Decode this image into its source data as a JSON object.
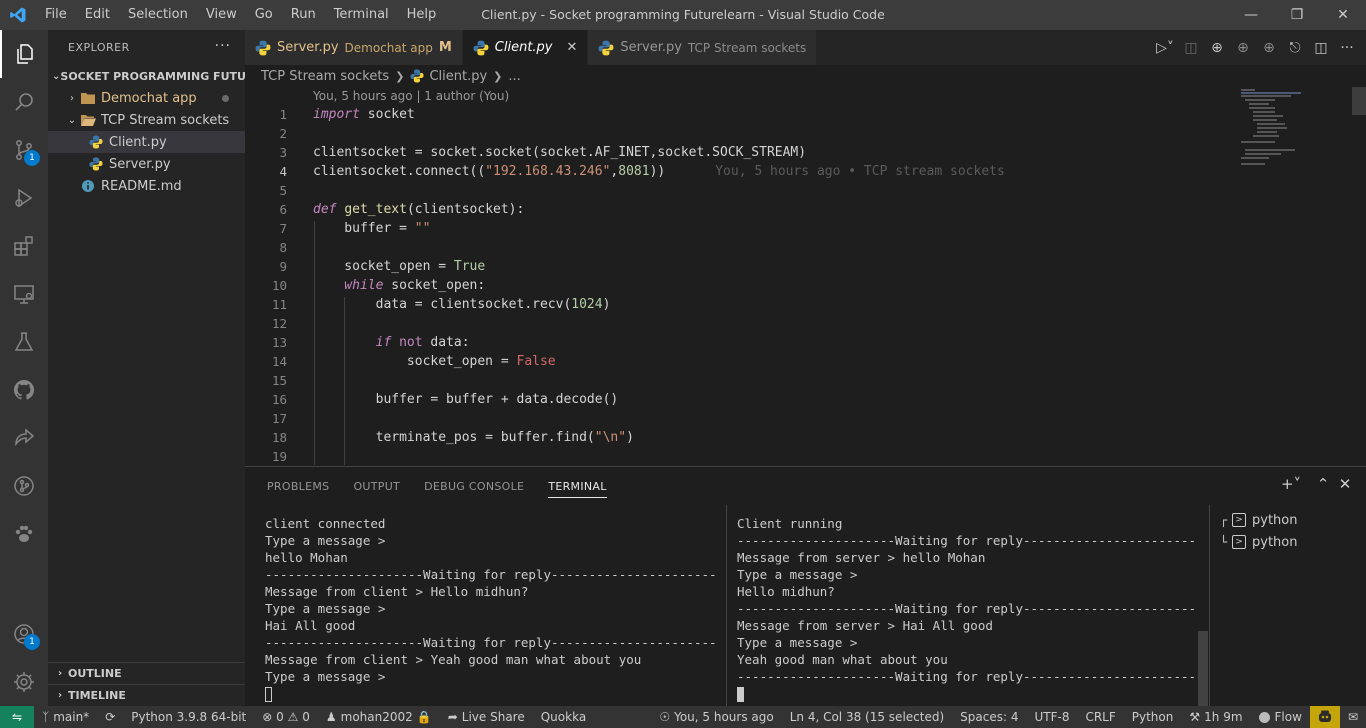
{
  "window": {
    "title": "Client.py - Socket programming Futurelearn - Visual Studio Code",
    "menu": [
      "File",
      "Edit",
      "Selection",
      "View",
      "Go",
      "Run",
      "Terminal",
      "Help"
    ]
  },
  "activity": {
    "scm_badge": "1",
    "accounts_badge": "1"
  },
  "sidebar": {
    "title": "EXPLORER",
    "root": "SOCKET PROGRAMMING FUTU...",
    "folders": [
      {
        "label": "Demochat app"
      },
      {
        "label": "TCP Stream sockets"
      }
    ],
    "files": [
      {
        "label": "Client.py"
      },
      {
        "label": "Server.py"
      },
      {
        "label": "README.md"
      }
    ],
    "outline": "OUTLINE",
    "timeline": "TIMELINE"
  },
  "tabs": [
    {
      "label": "Server.py",
      "desc": "Demochat app",
      "flag": "M"
    },
    {
      "label": "Client.py"
    },
    {
      "label": "Server.py",
      "desc": "TCP Stream sockets"
    }
  ],
  "breadcrumb": {
    "folder": "TCP Stream sockets",
    "file": "Client.py",
    "more": "..."
  },
  "editor": {
    "codelens": "You, 5 hours ago | 1 author (You)",
    "blame": "You, 5 hours ago • TCP stream sockets",
    "line_numbers": [
      "1",
      "2",
      "3",
      "4",
      "5",
      "6",
      "7",
      "8",
      "9",
      "10",
      "11",
      "12",
      "13",
      "14",
      "15",
      "16",
      "17",
      "18",
      "19"
    ],
    "tokens": {
      "import": "import",
      "socket": " socket",
      "l3a": "clientsocket = socket.socket(socket.AF_INET,socket.SOCK_STREAM)",
      "l4a": "clientsocket.connect((",
      "l4s": "\"192.168.43.246\"",
      "l4c": ",",
      "l4n": "8081",
      "l4d": "))",
      "def": "def",
      "fn": "get_text",
      "l6p": "(clientsocket):",
      "l7a": "    buffer = ",
      "l7s": "\"\"",
      "l9a": "    socket_open = ",
      "true": "True",
      "while": "    while",
      "l10b": " socket_open:",
      "l11a": "        data = clientsocket.recv(",
      "l11n": "1024",
      "l11c": ")",
      "if": "        if",
      "not": " not",
      "l13c": " data:",
      "l14a": "            socket_open = ",
      "false": "False",
      "l16a": "        buffer = buffer + data.decode()",
      "l18a": "        terminate_pos = buffer.find(",
      "l18s": "\"\\n\"",
      "l18c": ")"
    }
  },
  "panel": {
    "tabs": [
      "PROBLEMS",
      "OUTPUT",
      "DEBUG CONSOLE",
      "TERMINAL"
    ],
    "term_left": [
      "client connected",
      "Type a message >",
      "hello Mohan",
      "---------------------Waiting for reply----------------------",
      "Message from client > Hello midhun?",
      "Type a message >",
      "Hai All good",
      "---------------------Waiting for reply----------------------",
      "Message from client > Yeah good man what about you",
      "Type a message >"
    ],
    "term_right": [
      "Client running",
      "---------------------Waiting for reply-----------------------",
      "Message from server > hello Mohan",
      "Type a message >",
      "Hello midhun?",
      "---------------------Waiting for reply-----------------------",
      "Message from server > Hai All good",
      "Type a message >",
      "Yeah good man what about you",
      "---------------------Waiting for reply-----------------------"
    ],
    "terminals": [
      "python",
      "python"
    ]
  },
  "status": {
    "branch": "main*",
    "python": "Python 3.9.8 64-bit",
    "errors": "0",
    "warnings": "0",
    "user": "mohan2002",
    "liveshare": "Live Share",
    "quokka": "Quokka",
    "blame": "You, 5 hours ago",
    "position": "Ln 4, Col 38 (15 selected)",
    "spaces": "Spaces: 4",
    "encoding": "UTF-8",
    "eol": "CRLF",
    "language": "Python",
    "time": "1h 9m",
    "flow": "Flow"
  }
}
